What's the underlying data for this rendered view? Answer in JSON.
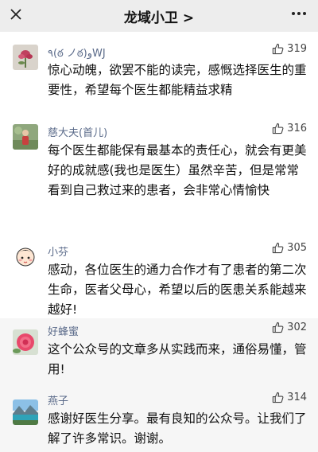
{
  "header": {
    "title": "龙域小卫 >"
  },
  "comments": [
    {
      "name": "٩(ఠ ノఠ)وWJ",
      "likes": "319",
      "text": "惊心动魄，欲罢不能的读完，感慨选择医生的重要性，希望每个医生都能精益求精"
    },
    {
      "name": "慈大夫(首儿)",
      "likes": "316",
      "text": "每个医生都能保有最基本的责任心，就会有更美好的成就感(我也是医生）虽然辛苦，但是常常看到自己救过来的患者，会非常心情愉快"
    },
    {
      "name": "小芬",
      "likes": "305",
      "text": "感动，各位医生的通力合作才有了患者的第二次生命，医者父母心，希望以后的医患关系能越来越好!"
    },
    {
      "name": "好蜂蜜",
      "likes": "302",
      "text": "这个公众号的文章多从实践而来，通俗易懂，管用!"
    },
    {
      "name": "燕子",
      "likes": "314",
      "text": "感谢好医生分享。最有良知的公众号。让我们了解了许多常识。谢谢。"
    }
  ],
  "colors": {
    "background": "#ededed",
    "name": "#5b6b8a",
    "text": "#111111"
  }
}
